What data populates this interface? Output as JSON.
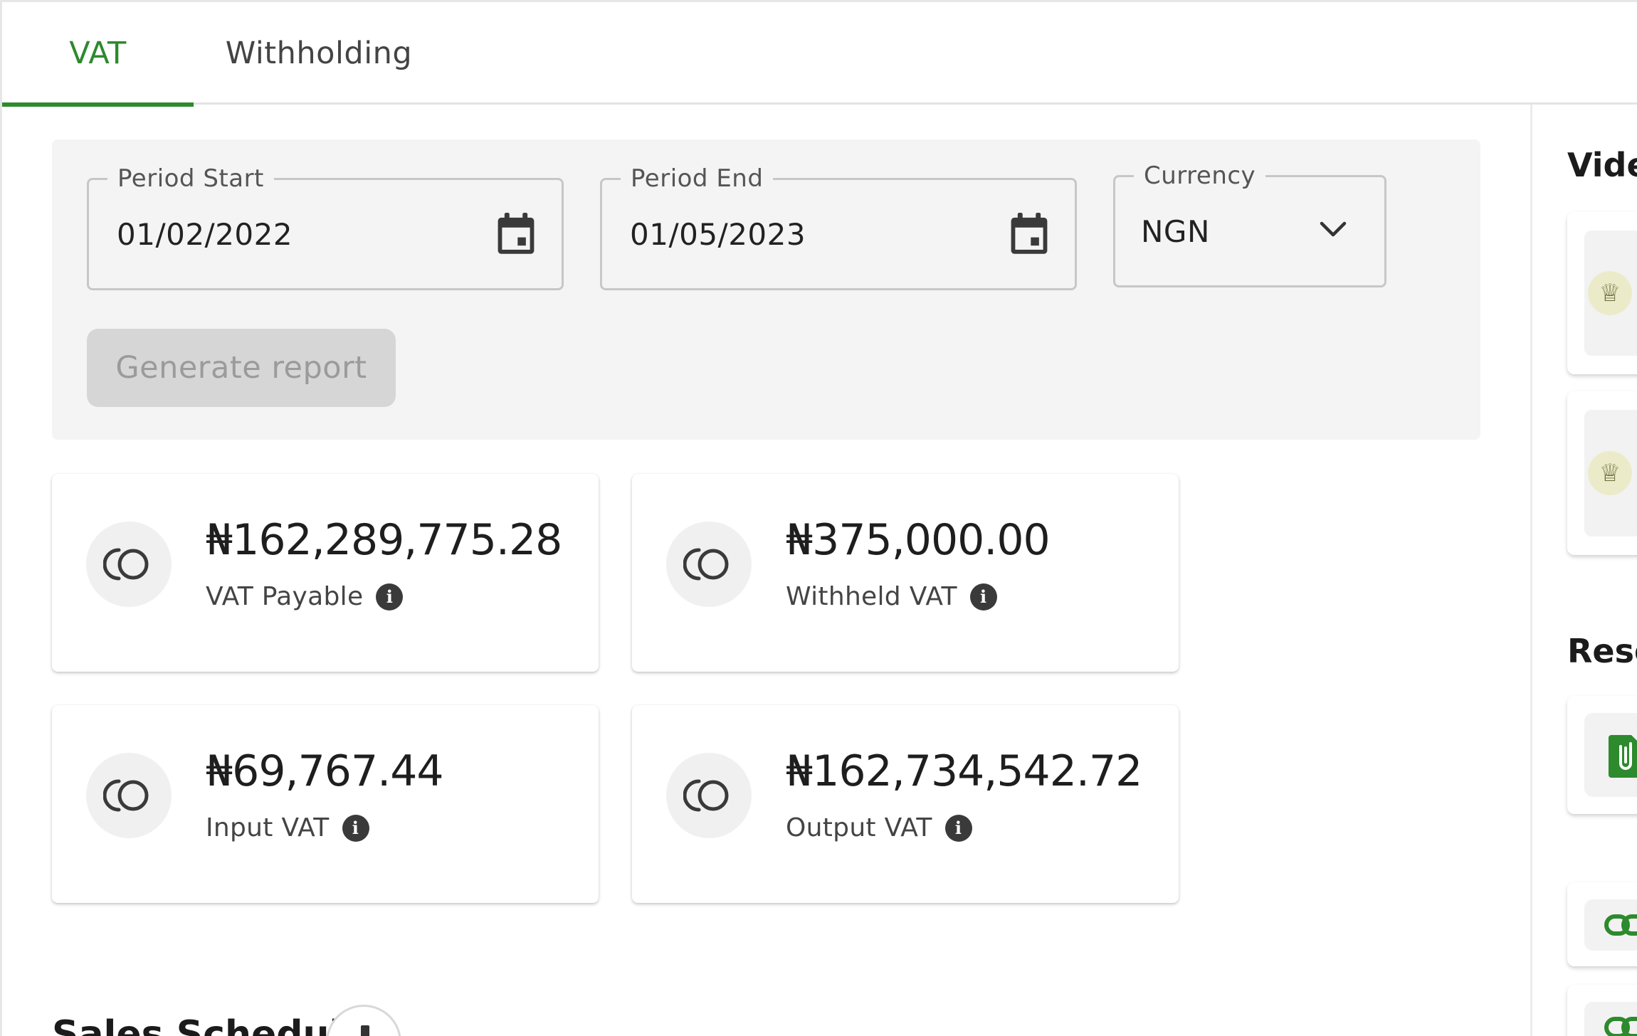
{
  "tabs": [
    {
      "label": "VAT",
      "active": true
    },
    {
      "label": "Withholding",
      "active": false
    }
  ],
  "filters": {
    "period_start": {
      "label": "Period Start",
      "value": "01/02/2022"
    },
    "period_end": {
      "label": "Period End",
      "value": "01/05/2023"
    },
    "currency": {
      "label": "Currency",
      "value": "NGN"
    },
    "generate_label": "Generate report"
  },
  "stats": [
    {
      "amount": "₦162,289,775.28",
      "label": "VAT Payable"
    },
    {
      "amount": "₦375,000.00",
      "label": "Withheld VAT"
    },
    {
      "amount": "₦69,767.44",
      "label": "Input VAT"
    },
    {
      "amount": "₦162,734,542.72",
      "label": "Output VAT"
    }
  ],
  "side_panel": {
    "videos_heading": "Vide",
    "resources_heading": "Reso"
  },
  "bottom": {
    "section_title": "Sales Schedule"
  },
  "colors": {
    "accent": "#2d8a2d",
    "panel_bg": "#f4f4f4",
    "disabled_button": "#d6d6d6"
  },
  "icons": {
    "date_picker": "calendar-icon",
    "dropdown": "chevron-down-icon",
    "stat": "coins-icon",
    "info": "info-icon",
    "attachment": "paperclip-icon",
    "link": "link-icon",
    "emblem": "coat-of-arms-icon"
  }
}
